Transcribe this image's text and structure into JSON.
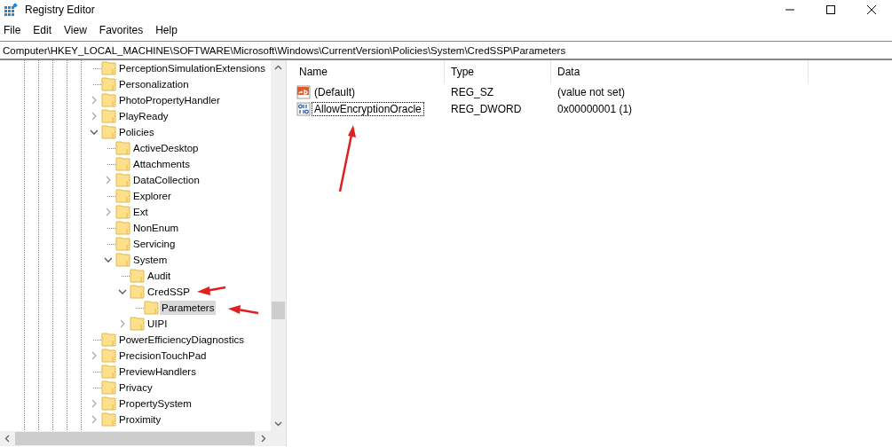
{
  "window": {
    "title": "Registry Editor"
  },
  "menu": [
    "File",
    "Edit",
    "View",
    "Favorites",
    "Help"
  ],
  "address": "Computer\\HKEY_LOCAL_MACHINE\\SOFTWARE\\Microsoft\\Windows\\CurrentVersion\\Policies\\System\\CredSSP\\Parameters",
  "tree": [
    {
      "label": "PerceptionSimulationExtensions",
      "kind": "leaf",
      "selected": false
    },
    {
      "label": "Personalization",
      "kind": "leaf",
      "selected": false
    },
    {
      "label": "PhotoPropertyHandler",
      "kind": "branch",
      "expanded": false,
      "selected": false
    },
    {
      "label": "PlayReady",
      "kind": "branch",
      "expanded": false,
      "selected": false
    },
    {
      "label": "Policies",
      "kind": "branch",
      "expanded": true,
      "selected": false,
      "children": [
        {
          "label": "ActiveDesktop",
          "kind": "leaf",
          "selected": false
        },
        {
          "label": "Attachments",
          "kind": "leaf",
          "selected": false
        },
        {
          "label": "DataCollection",
          "kind": "branch",
          "expanded": false,
          "selected": false
        },
        {
          "label": "Explorer",
          "kind": "leaf",
          "selected": false
        },
        {
          "label": "Ext",
          "kind": "branch",
          "expanded": false,
          "selected": false
        },
        {
          "label": "NonEnum",
          "kind": "leaf",
          "selected": false
        },
        {
          "label": "Servicing",
          "kind": "leaf",
          "selected": false
        },
        {
          "label": "System",
          "kind": "branch",
          "expanded": true,
          "selected": false,
          "children": [
            {
              "label": "Audit",
              "kind": "leaf",
              "selected": false
            },
            {
              "label": "CredSSP",
              "kind": "branch",
              "expanded": true,
              "selected": false,
              "children": [
                {
                  "label": "Parameters",
                  "kind": "leaf",
                  "selected": true
                }
              ]
            },
            {
              "label": "UIPI",
              "kind": "branch",
              "expanded": false,
              "selected": false
            }
          ]
        }
      ]
    },
    {
      "label": "PowerEfficiencyDiagnostics",
      "kind": "leaf",
      "selected": false
    },
    {
      "label": "PrecisionTouchPad",
      "kind": "branch",
      "expanded": false,
      "selected": false
    },
    {
      "label": "PreviewHandlers",
      "kind": "leaf",
      "selected": false
    },
    {
      "label": "Privacy",
      "kind": "leaf",
      "selected": false
    },
    {
      "label": "PropertySystem",
      "kind": "branch",
      "expanded": false,
      "selected": false
    },
    {
      "label": "Proximity",
      "kind": "branch",
      "expanded": false,
      "selected": false
    }
  ],
  "values": {
    "columns": [
      "Name",
      "Type",
      "Data"
    ],
    "rows": [
      {
        "name": "(Default)",
        "kind": "string",
        "type": "REG_SZ",
        "data": "(value not set)",
        "focused": false
      },
      {
        "name": "AllowEncryptionOracle",
        "kind": "binary",
        "type": "REG_DWORD",
        "data": "0x00000001 (1)",
        "focused": true
      }
    ]
  }
}
